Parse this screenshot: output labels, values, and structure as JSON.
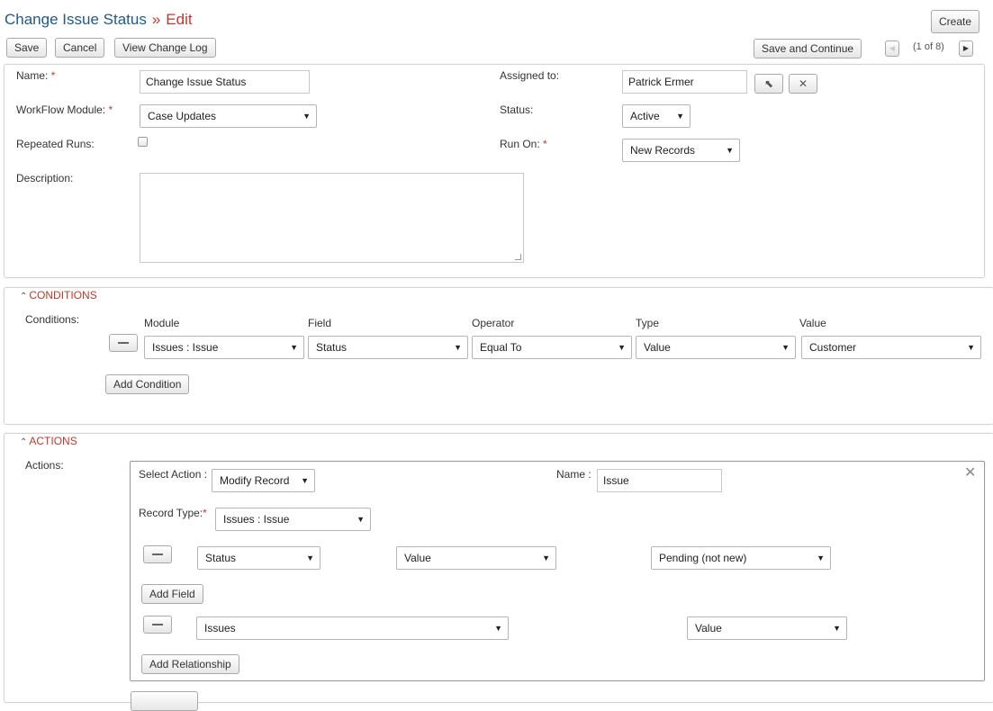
{
  "header": {
    "module": "Change Issue Status",
    "separator": "»",
    "mode": "Edit",
    "create_label": "Create"
  },
  "toolbar": {
    "save": "Save",
    "cancel": "Cancel",
    "view_change_log": "View Change Log",
    "save_continue": "Save and Continue",
    "pagination": "(1 of 8)"
  },
  "form": {
    "name_label": "Name:",
    "name_value": "Change Issue Status",
    "workflow_module_label": "WorkFlow Module:",
    "workflow_module_value": "Case Updates",
    "repeated_runs_label": "Repeated Runs:",
    "repeated_runs_checked": false,
    "description_label": "Description:",
    "description_value": "",
    "assigned_to_label": "Assigned to:",
    "assigned_to_value": "Patrick Ermer",
    "status_label": "Status:",
    "status_value": "Active",
    "run_on_label": "Run On:",
    "run_on_value": "New Records",
    "required_mark": "*"
  },
  "conditions": {
    "section_title": "CONDITIONS",
    "label": "Conditions:",
    "headers": {
      "module": "Module",
      "field": "Field",
      "operator": "Operator",
      "type": "Type",
      "value": "Value"
    },
    "rows": [
      {
        "module": "Issues : Issue",
        "field": "Status",
        "operator": "Equal To",
        "type": "Value",
        "value": "Customer"
      }
    ],
    "add_label": "Add Condition"
  },
  "actions": {
    "section_title": "ACTIONS",
    "label": "Actions:",
    "select_action_label": "Select Action :",
    "select_action_value": "Modify Record",
    "name_label": "Name :",
    "name_value": "Issue",
    "record_type_label": "Record Type:",
    "record_type_value": "Issues : Issue",
    "field_row": {
      "field": "Status",
      "type": "Value",
      "value": "Pending (not new)"
    },
    "add_field_label": "Add Field",
    "relationship_row": {
      "relation": "Issues",
      "type": "Value"
    },
    "add_relationship_label": "Add Relationship"
  },
  "icons": {
    "caret": "▼",
    "chevron_up": "⌃",
    "close": "✕",
    "pointer": "⬉",
    "clear": "✕",
    "prev": "◀",
    "next": "▶"
  },
  "colors": {
    "title_blue": "#1f5a8a",
    "accent_red": "#c0392b"
  }
}
